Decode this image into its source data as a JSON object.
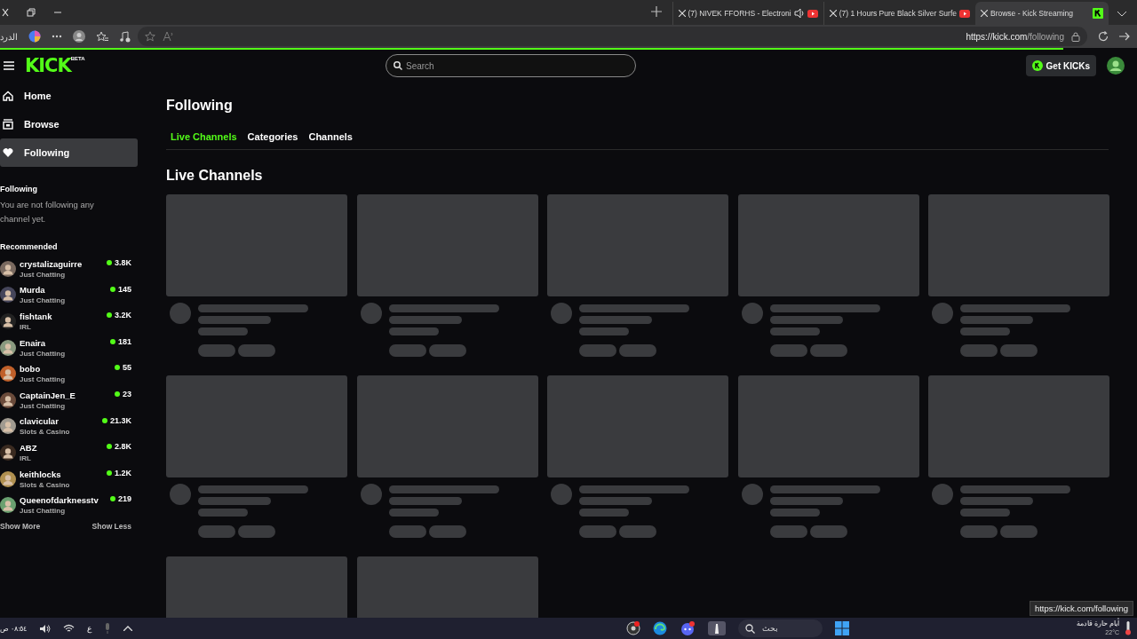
{
  "browser": {
    "tabs": [
      {
        "title": "(7) NIVEK FFORHS - Electroni",
        "selected": false,
        "audio": true
      },
      {
        "title": "(7) 1 Hours Pure Black Silver Surfe",
        "selected": false,
        "audio": false
      },
      {
        "title": "Browse - Kick Streaming",
        "selected": true,
        "audio": false
      }
    ],
    "sidebar_label": "الدرد",
    "url_host": "https://kick.com",
    "url_path": "/following",
    "load": {
      "level": 0.935
    }
  },
  "header": {
    "search": {
      "placeholder": "Search"
    },
    "get_kicks": "Get KICKs",
    "logo": "KICK",
    "logo_badge": "BETA"
  },
  "sidebar": {
    "nav": [
      {
        "label": "Home",
        "selected": false
      },
      {
        "label": "Browse",
        "selected": false
      },
      {
        "label": "Following",
        "selected": true
      }
    ],
    "following_title": "Following",
    "following_empty": "You are not following any channel yet.",
    "recommended_title": "Recommended",
    "channels": [
      {
        "name": "crystalizaguirre",
        "category": "Just Chatting",
        "viewers": "3.8K"
      },
      {
        "name": "Murda",
        "category": "Just Chatting",
        "viewers": "145"
      },
      {
        "name": "fishtank",
        "category": "IRL",
        "viewers": "3.2K"
      },
      {
        "name": "Enaira",
        "category": "Just Chatting",
        "viewers": "181"
      },
      {
        "name": "bobo",
        "category": "Just Chatting",
        "viewers": "55"
      },
      {
        "name": "CaptainJen_E",
        "category": "Just Chatting",
        "viewers": "23"
      },
      {
        "name": "clavicular",
        "category": "Slots & Casino",
        "viewers": "21.3K"
      },
      {
        "name": "ABZ",
        "category": "IRL",
        "viewers": "2.8K"
      },
      {
        "name": "keithlocks",
        "category": "Slots & Casino",
        "viewers": "1.2K"
      },
      {
        "name": "Queenofdarknesstv",
        "category": "Just Chatting",
        "viewers": "219"
      }
    ],
    "show_more": "Show More",
    "show_less": "Show Less"
  },
  "page": {
    "title": "Following",
    "tabs": [
      {
        "label": "Live Channels",
        "selected": true
      },
      {
        "label": "Categories",
        "selected": false
      },
      {
        "label": "Channels",
        "selected": false
      }
    ],
    "section_title": "Live Channels",
    "cards": [
      {
        "kind": "skeleton"
      },
      {
        "kind": "skeleton"
      },
      {
        "kind": "skeleton"
      },
      {
        "kind": "skeleton"
      },
      {
        "kind": "skeleton"
      },
      {
        "kind": "skeleton"
      },
      {
        "kind": "skeleton"
      },
      {
        "kind": "skeleton"
      },
      {
        "kind": "skeleton"
      },
      {
        "kind": "skeleton"
      },
      {
        "kind": "thumbnail"
      },
      {
        "kind": "thumbnail"
      }
    ]
  },
  "status_url": "https://kick.com/following",
  "taskbar": {
    "time": "٠٨:٥٤ ص",
    "language": "ع",
    "search": "بحث",
    "weather": "أيام حارة قادمة",
    "temperature": "22°C"
  }
}
